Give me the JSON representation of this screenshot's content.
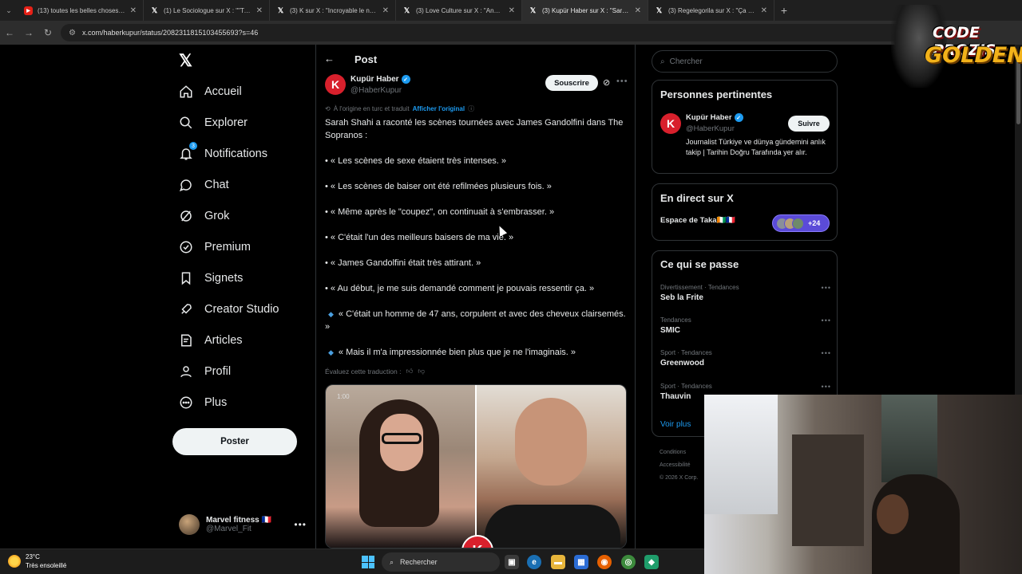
{
  "browser": {
    "tabs": [
      {
        "icon": "youtube-icon",
        "title": "(13) toutes les belles choses on",
        "active": false
      },
      {
        "icon": "x-icon",
        "title": "(1) Le Sociologue sur X : \"\"Tu n",
        "active": false
      },
      {
        "icon": "x-icon",
        "title": "(3) K sur X : \"Incroyable le nouv",
        "active": false
      },
      {
        "icon": "x-icon",
        "title": "(3) Love Culture sur X : \"Angeli",
        "active": false
      },
      {
        "icon": "x-icon",
        "title": "(3) Kupür Haber sur X : \"Sarah S",
        "active": true
      },
      {
        "icon": "x-icon",
        "title": "(3) Regelegorila sur X : \"Ça dev",
        "active": false
      }
    ],
    "url": "x.com/haberkupur/status/2082311815103455693?s=46"
  },
  "nav": {
    "items": [
      {
        "icon": "home-icon",
        "label": "Accueil"
      },
      {
        "icon": "search-icon",
        "label": "Explorer"
      },
      {
        "icon": "bell-icon",
        "label": "Notifications",
        "badge": "3"
      },
      {
        "icon": "chat-icon",
        "label": "Chat"
      },
      {
        "icon": "grok-icon",
        "label": "Grok"
      },
      {
        "icon": "verified-icon",
        "label": "Premium"
      },
      {
        "icon": "bookmark-icon",
        "label": "Signets"
      },
      {
        "icon": "rocket-icon",
        "label": "Creator Studio"
      },
      {
        "icon": "article-icon",
        "label": "Articles"
      },
      {
        "icon": "person-icon",
        "label": "Profil"
      },
      {
        "icon": "more-circle-icon",
        "label": "Plus"
      }
    ],
    "post_button": "Poster",
    "account": {
      "name": "Marvel fitness 🇫🇷",
      "handle": "@Marvel_Fit"
    }
  },
  "post": {
    "header_title": "Post",
    "author_name": "Kupür Haber",
    "author_handle": "@HaberKupur",
    "author_initial": "K",
    "subscribe_label": "Souscrire",
    "translated_text": "À l'origine en turc et traduit",
    "show_original": "Afficher l'original",
    "paragraphs": [
      "Sarah Shahi a raconté les scènes tournées avec James Gandolfini dans The Sopranos :",
      "• « Les scènes de sexe étaient très intenses. »",
      "• « Les scènes de baiser ont été refilmées plusieurs fois. »",
      "• « Même après le \"coupez\", on continuait à s'embrasser. »",
      "• « C'était l'un des meilleurs baisers de ma vie. »",
      "• « James Gandolfini était très attirant. »",
      "• « Au début, je me suis demandé comment je pouvais ressentir ça. »",
      "« C'était un homme de 47 ans, corpulent et avec des cheveux clairsemés. »",
      "« Mais il m'a impressionnée bien plus que je ne l'imaginais. »"
    ],
    "rate_translation": "Évaluez cette traduction :",
    "video_time": "1:00",
    "image_logo": "K"
  },
  "right": {
    "search_placeholder": "Chercher",
    "relevant": {
      "title": "Personnes pertinentes",
      "name": "Kupür Haber",
      "handle": "@HaberKupur",
      "initial": "K",
      "follow_label": "Suivre",
      "bio": "Journalist Türkiye ve dünya gündemini anlık takip | Tarihin Doğru Tarafında yer alır."
    },
    "live": {
      "title": "En direct sur X",
      "space_name": "Espace de Taka🇨🇮🇫🇷",
      "listener_count": "+24"
    },
    "trends": {
      "title": "Ce qui se passe",
      "items": [
        {
          "category": "Divertissement · Tendances",
          "name": "Seb la Frite"
        },
        {
          "category": "Tendances",
          "name": "SMIC"
        },
        {
          "category": "Sport · Tendances",
          "name": "Greenwood"
        },
        {
          "category": "Sport · Tendances",
          "name": "Thauvin"
        }
      ],
      "show_more": "Voir plus"
    },
    "footer": [
      "Conditions",
      "Accessibilité",
      "© 2026 X Corp."
    ]
  },
  "overlay": {
    "badge_line1": "CODE PROZIS",
    "badge_line2": "GOLDENG"
  },
  "taskbar": {
    "temperature": "23°C",
    "weather": "Très ensoleillé",
    "search_label": "Rechercher"
  },
  "colors": {
    "accent": "#1d9bf0",
    "brand_red": "#d8202c",
    "background": "#000000"
  }
}
